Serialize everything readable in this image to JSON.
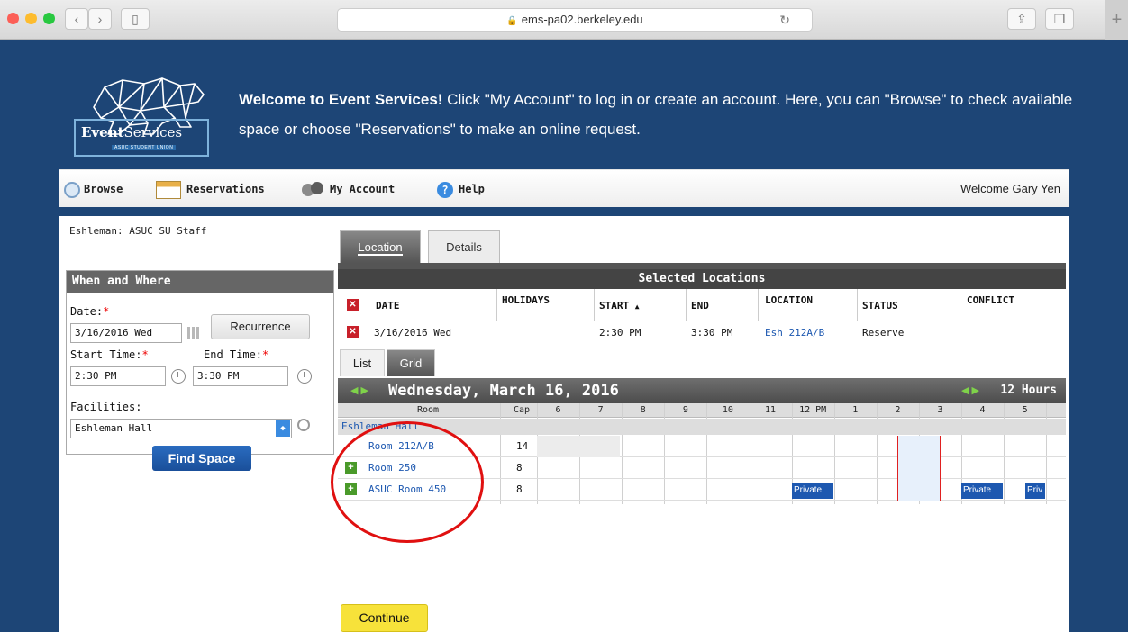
{
  "browser": {
    "url": "ems-pa02.berkeley.edu"
  },
  "header": {
    "logo_word_bold": "Event",
    "logo_word_regular": "Services",
    "logo_subtitle": "ASUC STUDENT UNION",
    "welcome_bold": "Welcome to Event Services!",
    "welcome_rest": " Click \"My Account\" to log in or create an account. Here, you can \"Browse\" to check available space or choose \"Reservations\" to make an online request."
  },
  "nav": {
    "items": [
      {
        "label": "Browse",
        "icon": "magnifier-icon"
      },
      {
        "label": "Reservations",
        "icon": "calendar-icon"
      },
      {
        "label": "My Account",
        "icon": "users-icon"
      },
      {
        "label": "Help",
        "icon": "help-icon"
      }
    ],
    "welcome_user": "Welcome Gary Yen"
  },
  "sidebar": {
    "group_name": "Eshleman: ASUC SU Staff",
    "panel_title": "When and Where",
    "date_label": "Date:",
    "date_value": "3/16/2016 Wed",
    "recurrence_label": "Recurrence",
    "start_time_label": "Start Time:",
    "start_time_value": "2:30 PM",
    "end_time_label": "End Time:",
    "end_time_value": "3:30 PM",
    "facilities_label": "Facilities:",
    "facilities_value": "Eshleman Hall",
    "find_space_label": "Find Space"
  },
  "tabs": {
    "location": "Location",
    "details": "Details"
  },
  "selected_locations": {
    "title": "Selected Locations",
    "columns": [
      "DATE",
      "HOLIDAYS",
      "START",
      "END",
      "LOCATION",
      "STATUS",
      "CONFLICT"
    ],
    "sort_indicator": "▲",
    "row": {
      "date": "3/16/2016 Wed",
      "start": "2:30 PM",
      "end": "3:30 PM",
      "location": "Esh 212A/B",
      "status": "Reserve"
    }
  },
  "view_tabs": {
    "list": "List",
    "grid": "Grid"
  },
  "grid": {
    "day_label": "Wednesday, March 16, 2016",
    "hours_label": "12 Hours",
    "room_header": "Room",
    "cap_header": "Cap",
    "hours": [
      "6",
      "7",
      "8",
      "9",
      "10",
      "11",
      "12 PM",
      "1",
      "2",
      "3",
      "4",
      "5"
    ],
    "building": "Eshleman Hall",
    "rooms": [
      {
        "name": "Room 212A/B",
        "cap": "14"
      },
      {
        "name": "Room 250",
        "cap": "8"
      },
      {
        "name": "ASUC Room 450",
        "cap": "8"
      }
    ],
    "booking_label": "Private",
    "booking_label_truncated": "Priv"
  },
  "continue_label": "Continue",
  "colors": {
    "header_bg": "#1d4576",
    "link": "#1d58b0",
    "annotation_circle": "#e01010",
    "continue_button": "#f7e23a"
  }
}
